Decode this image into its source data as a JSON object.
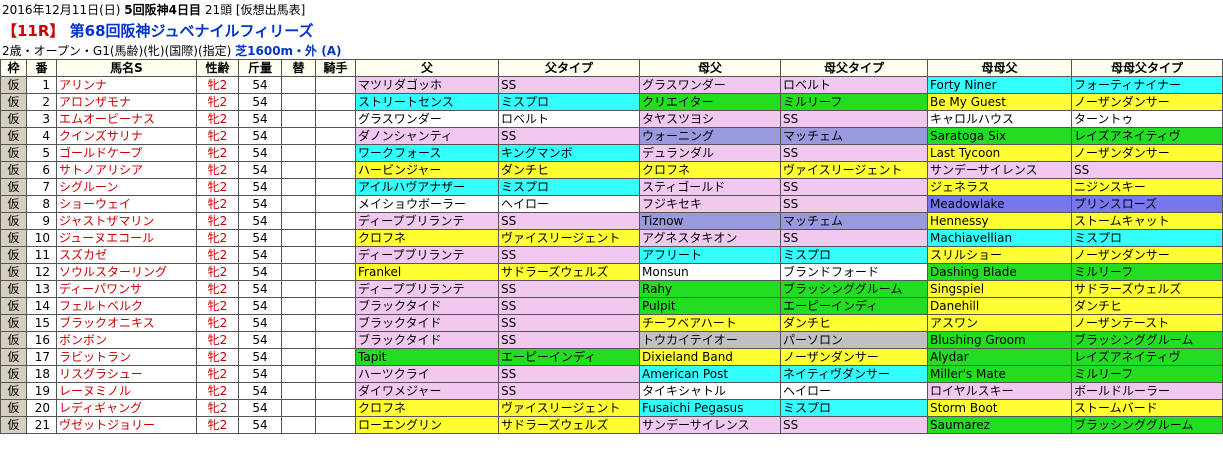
{
  "header": {
    "date": "2016年12月11日(日)",
    "meeting": "5回阪神4日目",
    "runners": "21頭",
    "note": "[仮想出馬表]",
    "race_no": "【11R】",
    "race_name": "第68回阪神ジュベナイルフィリーズ",
    "conditions": "2歳・オープン・G1(馬齢)(牝)(国際)(指定)",
    "course": "芝1600m・外 (A)"
  },
  "columns": [
    "枠",
    "番",
    "馬名S",
    "性齢",
    "斤量",
    "替",
    "騎手",
    "父",
    "父タイプ",
    "母父",
    "母父タイプ",
    "母母父",
    "母母父タイプ"
  ],
  "colors": {
    "pink": "#f0c8f0",
    "white": "#ffffff",
    "cyan": "#33ffff",
    "green": "#22dd22",
    "yellow": "#ffff33",
    "gray": "#c0c0c0",
    "lavender": "#9999dd",
    "purple": "#7777ee",
    "waku": "#d4cfbe",
    "header_bg": "#fffff0",
    "red_text": "#cc0000",
    "blue_text": "#0033cc"
  },
  "rows": [
    {
      "waku": "仮",
      "num": "1",
      "name": "アリンナ",
      "sex": "牝2",
      "wt": "54",
      "sire": "マツリダゴッホ",
      "sire_t": "SS",
      "dam_sire": "グラスワンダー",
      "dam_sire_t": "ロベルト",
      "dd_sire": "Forty Niner",
      "dd_sire_t": "フォーティナイナー",
      "c": [
        "pink",
        "pink",
        "pink",
        "pink",
        "cyan",
        "cyan"
      ]
    },
    {
      "waku": "仮",
      "num": "2",
      "name": "アロンザモナ",
      "sex": "牝2",
      "wt": "54",
      "sire": "ストリートセンス",
      "sire_t": "ミスプロ",
      "dam_sire": "クリエイター",
      "dam_sire_t": "ミルリーフ",
      "dd_sire": "Be My Guest",
      "dd_sire_t": "ノーザンダンサー",
      "c": [
        "cyan",
        "cyan",
        "green",
        "green",
        "yellow",
        "yellow"
      ]
    },
    {
      "waku": "仮",
      "num": "3",
      "name": "エムオービーナス",
      "sex": "牝2",
      "wt": "54",
      "sire": "グラスワンダー",
      "sire_t": "ロベルト",
      "dam_sire": "タヤスツヨシ",
      "dam_sire_t": "SS",
      "dd_sire": "キャロルハウス",
      "dd_sire_t": "ターントゥ",
      "c": [
        "white",
        "white",
        "pink",
        "pink",
        "white",
        "white"
      ]
    },
    {
      "waku": "仮",
      "num": "4",
      "name": "クインズサリナ",
      "sex": "牝2",
      "wt": "54",
      "sire": "ダノンシャンティ",
      "sire_t": "SS",
      "dam_sire": "ウォーニング",
      "dam_sire_t": "マッチェム",
      "dd_sire": "Saratoga Six",
      "dd_sire_t": "レイズアネイティヴ",
      "c": [
        "pink",
        "pink",
        "lavender",
        "lavender",
        "green",
        "green"
      ]
    },
    {
      "waku": "仮",
      "num": "5",
      "name": "ゴールドケープ",
      "sex": "牝2",
      "wt": "54",
      "sire": "ワークフォース",
      "sire_t": "キングマンボ",
      "dam_sire": "デュランダル",
      "dam_sire_t": "SS",
      "dd_sire": "Last Tycoon",
      "dd_sire_t": "ノーザンダンサー",
      "c": [
        "cyan",
        "cyan",
        "pink",
        "pink",
        "yellow",
        "yellow"
      ]
    },
    {
      "waku": "仮",
      "num": "6",
      "name": "サトノアリシア",
      "sex": "牝2",
      "wt": "54",
      "sire": "ハービンジャー",
      "sire_t": "ダンチヒ",
      "dam_sire": "クロフネ",
      "dam_sire_t": "ヴァイスリージェント",
      "dd_sire": "サンデーサイレンス",
      "dd_sire_t": "SS",
      "c": [
        "yellow",
        "yellow",
        "yellow",
        "yellow",
        "pink",
        "pink"
      ]
    },
    {
      "waku": "仮",
      "num": "7",
      "name": "シグルーン",
      "sex": "牝2",
      "wt": "54",
      "sire": "アイルハヴアナザー",
      "sire_t": "ミスプロ",
      "dam_sire": "スティゴールド",
      "dam_sire_t": "SS",
      "dd_sire": "ジェネラス",
      "dd_sire_t": "ニジンスキー",
      "c": [
        "cyan",
        "cyan",
        "pink",
        "pink",
        "yellow",
        "yellow"
      ]
    },
    {
      "waku": "仮",
      "num": "8",
      "name": "ショーウェイ",
      "sex": "牝2",
      "wt": "54",
      "sire": "メイショウボーラー",
      "sire_t": "ヘイロー",
      "dam_sire": "フジキセキ",
      "dam_sire_t": "SS",
      "dd_sire": "Meadowlake",
      "dd_sire_t": "プリンスローズ",
      "c": [
        "white",
        "white",
        "pink",
        "pink",
        "purple",
        "purple"
      ]
    },
    {
      "waku": "仮",
      "num": "9",
      "name": "ジャストザマリン",
      "sex": "牝2",
      "wt": "54",
      "sire": "ディープブリランテ",
      "sire_t": "SS",
      "dam_sire": "Tiznow",
      "dam_sire_t": "マッチェム",
      "dd_sire": "Hennessy",
      "dd_sire_t": "ストームキャット",
      "c": [
        "pink",
        "pink",
        "lavender",
        "lavender",
        "yellow",
        "yellow"
      ]
    },
    {
      "waku": "仮",
      "num": "10",
      "name": "ジューヌエコール",
      "sex": "牝2",
      "wt": "54",
      "sire": "クロフネ",
      "sire_t": "ヴァイスリージェント",
      "dam_sire": "アグネスタキオン",
      "dam_sire_t": "SS",
      "dd_sire": "Machiavellian",
      "dd_sire_t": "ミスプロ",
      "c": [
        "yellow",
        "yellow",
        "pink",
        "pink",
        "cyan",
        "cyan"
      ]
    },
    {
      "waku": "仮",
      "num": "11",
      "name": "スズカゼ",
      "sex": "牝2",
      "wt": "54",
      "sire": "ディープブリランテ",
      "sire_t": "SS",
      "dam_sire": "アフリート",
      "dam_sire_t": "ミスプロ",
      "dd_sire": "スリルショー",
      "dd_sire_t": "ノーザンダンサー",
      "c": [
        "pink",
        "pink",
        "cyan",
        "cyan",
        "yellow",
        "yellow"
      ]
    },
    {
      "waku": "仮",
      "num": "12",
      "name": "ソウルスターリング",
      "sex": "牝2",
      "wt": "54",
      "sire": "Frankel",
      "sire_t": "サドラーズウェルズ",
      "dam_sire": "Monsun",
      "dam_sire_t": "ブランドフォード",
      "dd_sire": "Dashing Blade",
      "dd_sire_t": "ミルリーフ",
      "c": [
        "yellow",
        "yellow",
        "white",
        "white",
        "green",
        "green"
      ]
    },
    {
      "waku": "仮",
      "num": "13",
      "name": "ディーパワンサ",
      "sex": "牝2",
      "wt": "54",
      "sire": "ディープブリランテ",
      "sire_t": "SS",
      "dam_sire": "Rahy",
      "dam_sire_t": "ブラッシンググルーム",
      "dd_sire": "Singspiel",
      "dd_sire_t": "サドラーズウェルズ",
      "c": [
        "pink",
        "pink",
        "green",
        "green",
        "yellow",
        "yellow"
      ]
    },
    {
      "waku": "仮",
      "num": "14",
      "name": "フェルトベルク",
      "sex": "牝2",
      "wt": "54",
      "sire": "ブラックタイド",
      "sire_t": "SS",
      "dam_sire": "Pulpit",
      "dam_sire_t": "エーピーインディ",
      "dd_sire": "Danehill",
      "dd_sire_t": "ダンチヒ",
      "c": [
        "pink",
        "pink",
        "green",
        "green",
        "yellow",
        "yellow"
      ]
    },
    {
      "waku": "仮",
      "num": "15",
      "name": "ブラックオニキス",
      "sex": "牝2",
      "wt": "54",
      "sire": "ブラックタイド",
      "sire_t": "SS",
      "dam_sire": "チーフベアハート",
      "dam_sire_t": "ダンチヒ",
      "dd_sire": "アスワン",
      "dd_sire_t": "ノーザンテースト",
      "c": [
        "pink",
        "pink",
        "yellow",
        "yellow",
        "yellow",
        "yellow"
      ]
    },
    {
      "waku": "仮",
      "num": "16",
      "name": "ボンボン",
      "sex": "牝2",
      "wt": "54",
      "sire": "ブラックタイド",
      "sire_t": "SS",
      "dam_sire": "トウカイテイオー",
      "dam_sire_t": "パーソロン",
      "dd_sire": "Blushing Groom",
      "dd_sire_t": "ブラッシンググルーム",
      "c": [
        "pink",
        "pink",
        "gray",
        "gray",
        "green",
        "green"
      ]
    },
    {
      "waku": "仮",
      "num": "17",
      "name": "ラビットラン",
      "sex": "牝2",
      "wt": "54",
      "sire": "Tapit",
      "sire_t": "エーピーインディ",
      "dam_sire": "Dixieland Band",
      "dam_sire_t": "ノーザンダンサー",
      "dd_sire": "Alydar",
      "dd_sire_t": "レイズアネイティヴ",
      "c": [
        "green",
        "green",
        "yellow",
        "yellow",
        "green",
        "green"
      ]
    },
    {
      "waku": "仮",
      "num": "18",
      "name": "リスグラシュー",
      "sex": "牝2",
      "wt": "54",
      "sire": "ハーツクライ",
      "sire_t": "SS",
      "dam_sire": "American Post",
      "dam_sire_t": "ネイティヴダンサー",
      "dd_sire": "Miller's Mate",
      "dd_sire_t": "ミルリーフ",
      "c": [
        "pink",
        "pink",
        "cyan",
        "cyan",
        "green",
        "green"
      ]
    },
    {
      "waku": "仮",
      "num": "19",
      "name": "レーヌミノル",
      "sex": "牝2",
      "wt": "54",
      "sire": "ダイワメジャー",
      "sire_t": "SS",
      "dam_sire": "タイキシャトル",
      "dam_sire_t": "ヘイロー",
      "dd_sire": "ロイヤルスキー",
      "dd_sire_t": "ボールドルーラー",
      "c": [
        "pink",
        "pink",
        "white",
        "white",
        "pink",
        "pink"
      ]
    },
    {
      "waku": "仮",
      "num": "20",
      "name": "レディギャング",
      "sex": "牝2",
      "wt": "54",
      "sire": "クロフネ",
      "sire_t": "ヴァイスリージェント",
      "dam_sire": "Fusaichi Pegasus",
      "dam_sire_t": "ミスプロ",
      "dd_sire": "Storm Boot",
      "dd_sire_t": "ストームバード",
      "c": [
        "yellow",
        "yellow",
        "cyan",
        "cyan",
        "yellow",
        "yellow"
      ]
    },
    {
      "waku": "仮",
      "num": "21",
      "name": "ヴゼットジョリー",
      "sex": "牝2",
      "wt": "54",
      "sire": "ローエングリン",
      "sire_t": "サドラーズウェルズ",
      "dam_sire": "サンデーサイレンス",
      "dam_sire_t": "SS",
      "dd_sire": "Saumarez",
      "dd_sire_t": "ブラッシンググルーム",
      "c": [
        "yellow",
        "yellow",
        "pink",
        "pink",
        "green",
        "green"
      ]
    }
  ]
}
